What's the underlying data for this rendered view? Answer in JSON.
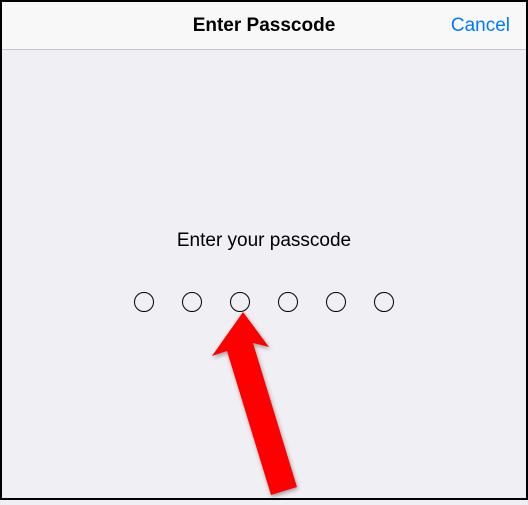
{
  "nav": {
    "title": "Enter Passcode",
    "cancel_label": "Cancel"
  },
  "prompt": "Enter your passcode",
  "passcode": {
    "length": 6,
    "filled": 0
  },
  "colors": {
    "accent": "#007aff",
    "background": "#efeff4",
    "navBackground": "#f8f8f8"
  },
  "annotation": {
    "arrow_color": "#ff0000",
    "arrow_target": "passcode-dot-3"
  }
}
